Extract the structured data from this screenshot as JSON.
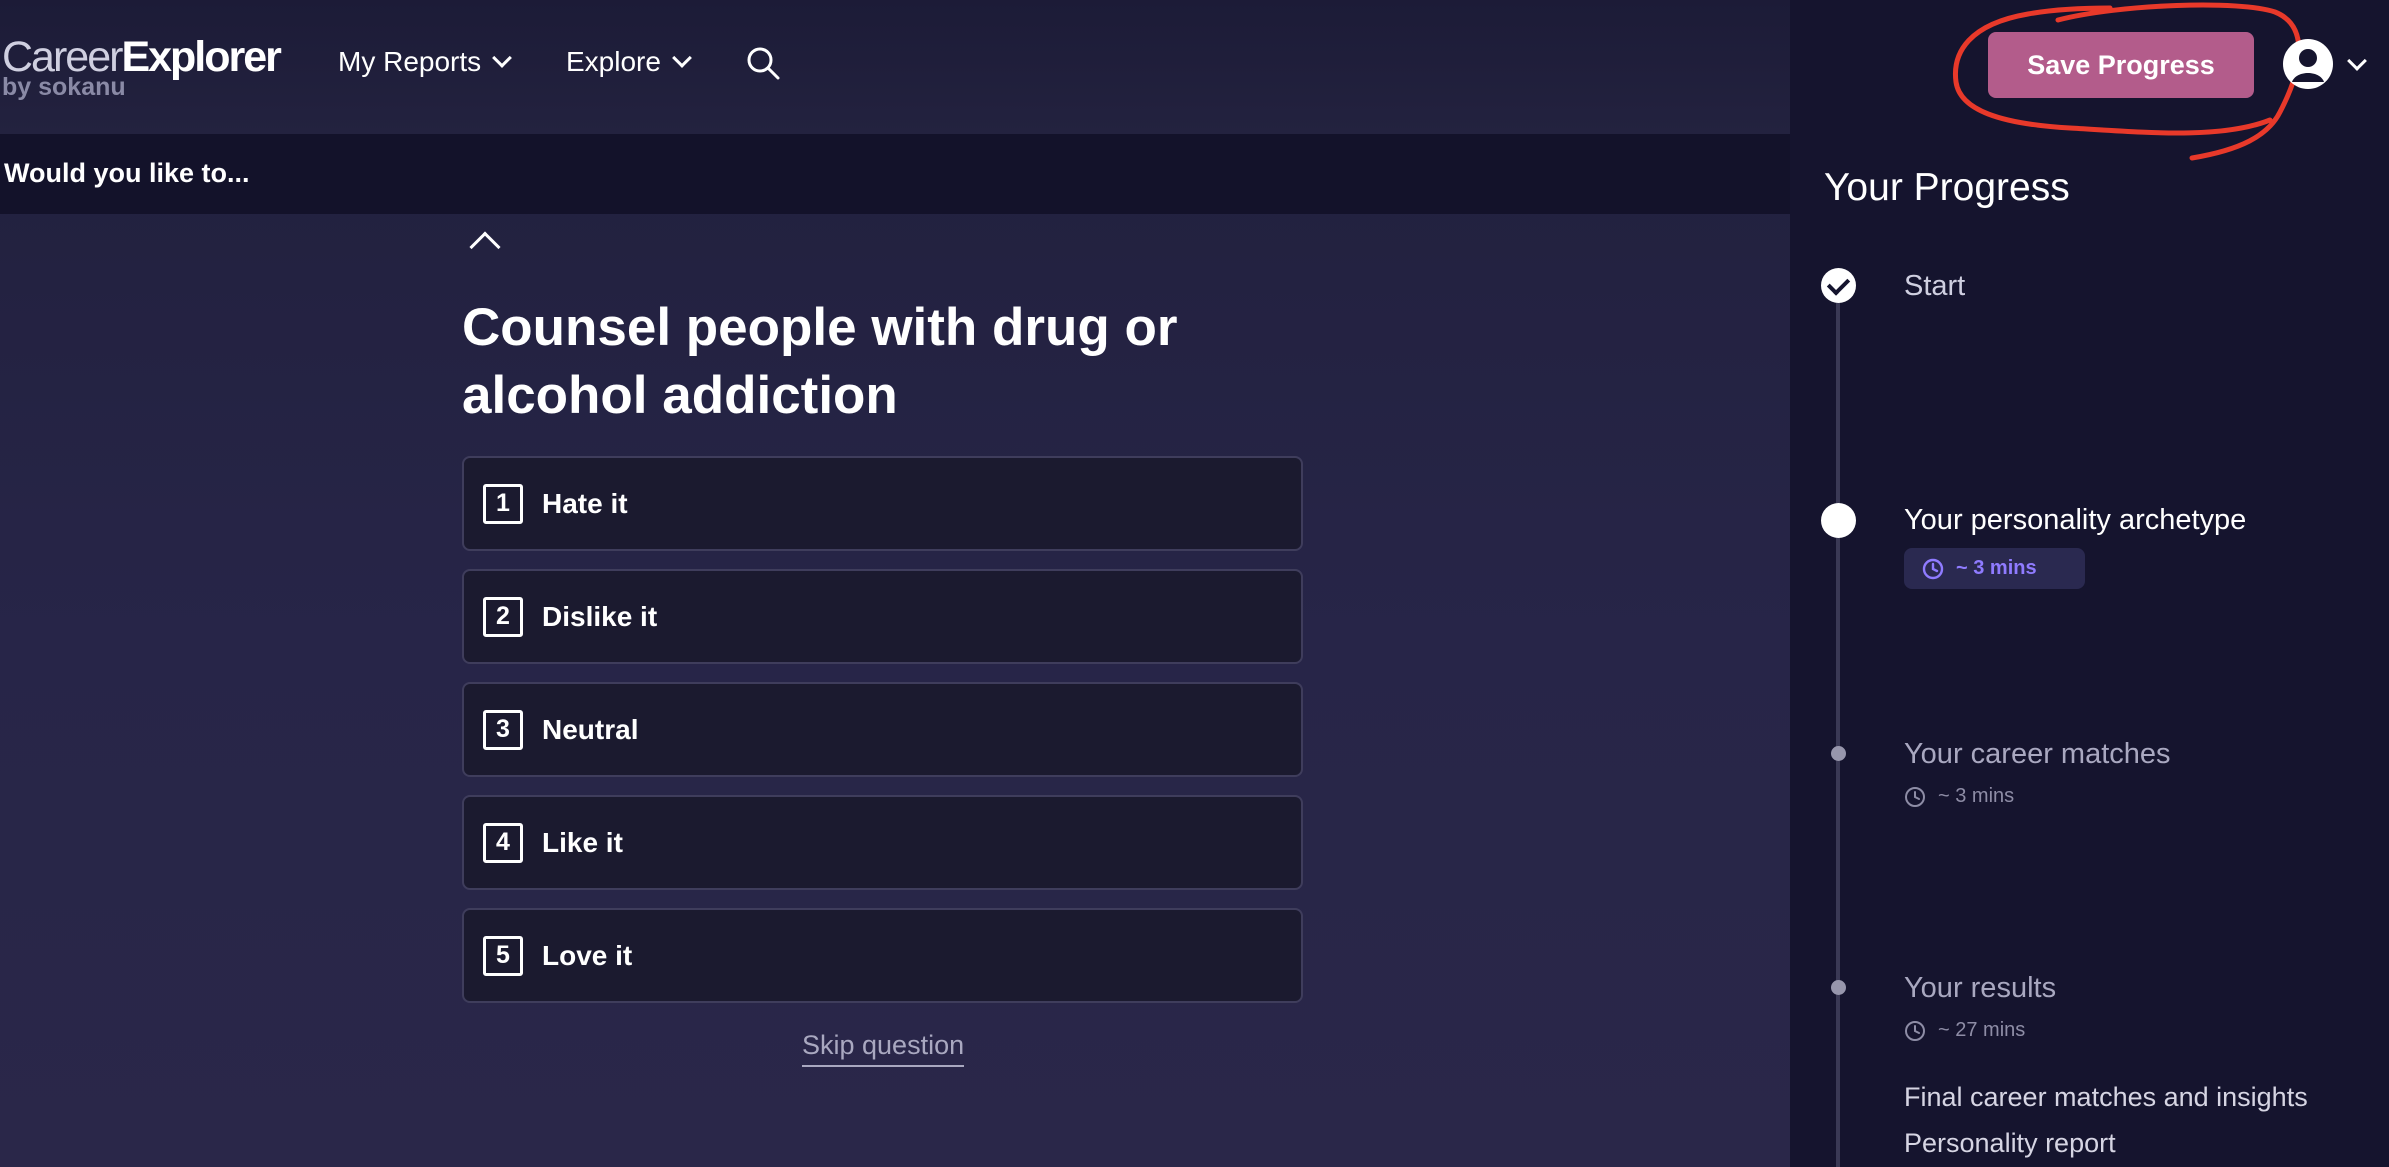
{
  "header": {
    "logo_part1": "Career",
    "logo_part2": "Explorer",
    "logo_sub": "by sokanu",
    "nav": [
      {
        "label": "My Reports"
      },
      {
        "label": "Explore"
      }
    ],
    "search_icon": "search-icon"
  },
  "subheader": {
    "label": "Would you like to..."
  },
  "question": {
    "text": "Counsel people with drug or alcohol addiction",
    "options": [
      {
        "num": "1",
        "label": "Hate it"
      },
      {
        "num": "2",
        "label": "Dislike it"
      },
      {
        "num": "3",
        "label": "Neutral"
      },
      {
        "num": "4",
        "label": "Like it"
      },
      {
        "num": "5",
        "label": "Love it"
      }
    ],
    "skip_label": "Skip question"
  },
  "sidebar": {
    "save_label": "Save Progress",
    "title": "Your Progress",
    "steps": [
      {
        "label": "Start",
        "status": "complete"
      },
      {
        "label": "Your personality archetype",
        "time": "~ 3 mins",
        "status": "current"
      },
      {
        "label": "Your career matches",
        "time": "~ 3 mins",
        "status": "upcoming"
      },
      {
        "label": "Your results",
        "time": "~ 27 mins",
        "status": "upcoming"
      }
    ],
    "results_items": [
      "Final career matches and insights",
      "Personality report"
    ]
  },
  "colors": {
    "save_button": "#b35c8b",
    "annotation": "#e8392a",
    "time_accent": "#8f7bff",
    "background": "#22213f",
    "sidebar": "#15142e"
  }
}
